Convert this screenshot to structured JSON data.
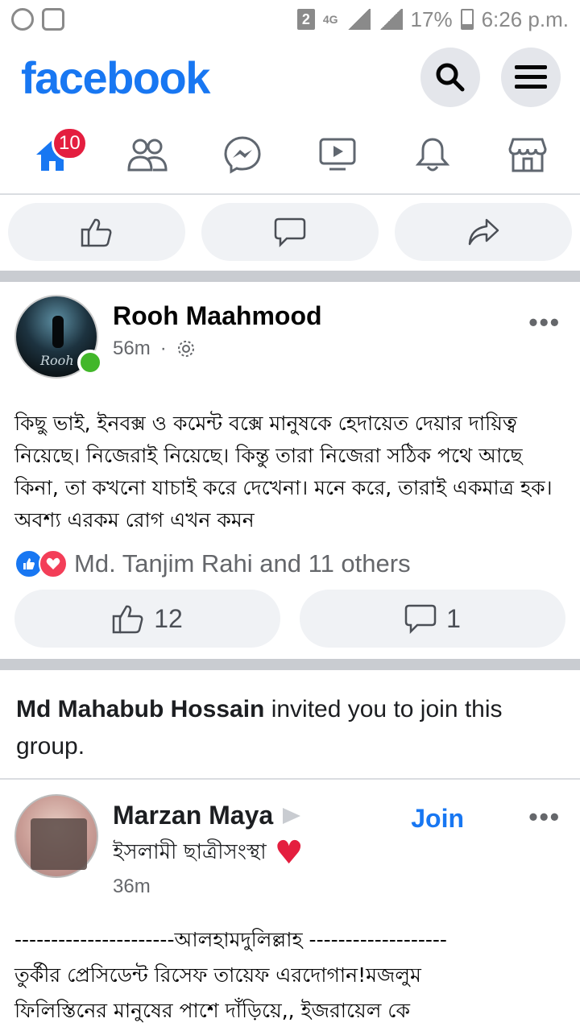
{
  "statusbar": {
    "sim": "2",
    "net": "4G",
    "battery": "17%",
    "time": "6:26 p.m."
  },
  "header": {
    "logo": "facebook"
  },
  "nav": {
    "home_badge": "10"
  },
  "post1": {
    "author": "Rooh Maahmood",
    "time": "56m",
    "avatar_signature": "Rooh",
    "text": "কিছু ভাই, ইনবক্স ও কমেন্ট বক্সে মানুষকে হেদায়েত দেয়ার দায়িত্ব নিয়েছে। নিজেরাই নিয়েছে। কিন্তু তারা নিজেরা সঠিক পথে আছে কিনা, তা কখনো যাচাই করে দেখেনা। মনে করে, তারাই একমাত্র হক। অবশ্য এরকম রোগ এখন কমন",
    "reactions": "Md. Tanjim Rahi and 11 others",
    "likes": "12",
    "comments": "1"
  },
  "invite": {
    "inviter": "Md Mahabub Hossain",
    "message": " invited you to join this group."
  },
  "post2": {
    "author": "Marzan Maya",
    "group": "ইসলামী ছাত্রীসংস্থা",
    "time": "36m",
    "join_label": "Join",
    "text_line1": "----------------------আলহামদুলিল্লাহ -------------------",
    "text_line2": "তুর্কীর প্রেসিডেন্ট রিসেফ তায়েফ এরদোগান!মজলুম",
    "text_line3": "ফিলিস্তিনের মানুষের পাশে দাঁড়িয়ে,, ইজরায়েল কে"
  },
  "colors": {
    "brand": "#1877f2",
    "badge": "#e41e3f",
    "online": "#42b72a"
  }
}
